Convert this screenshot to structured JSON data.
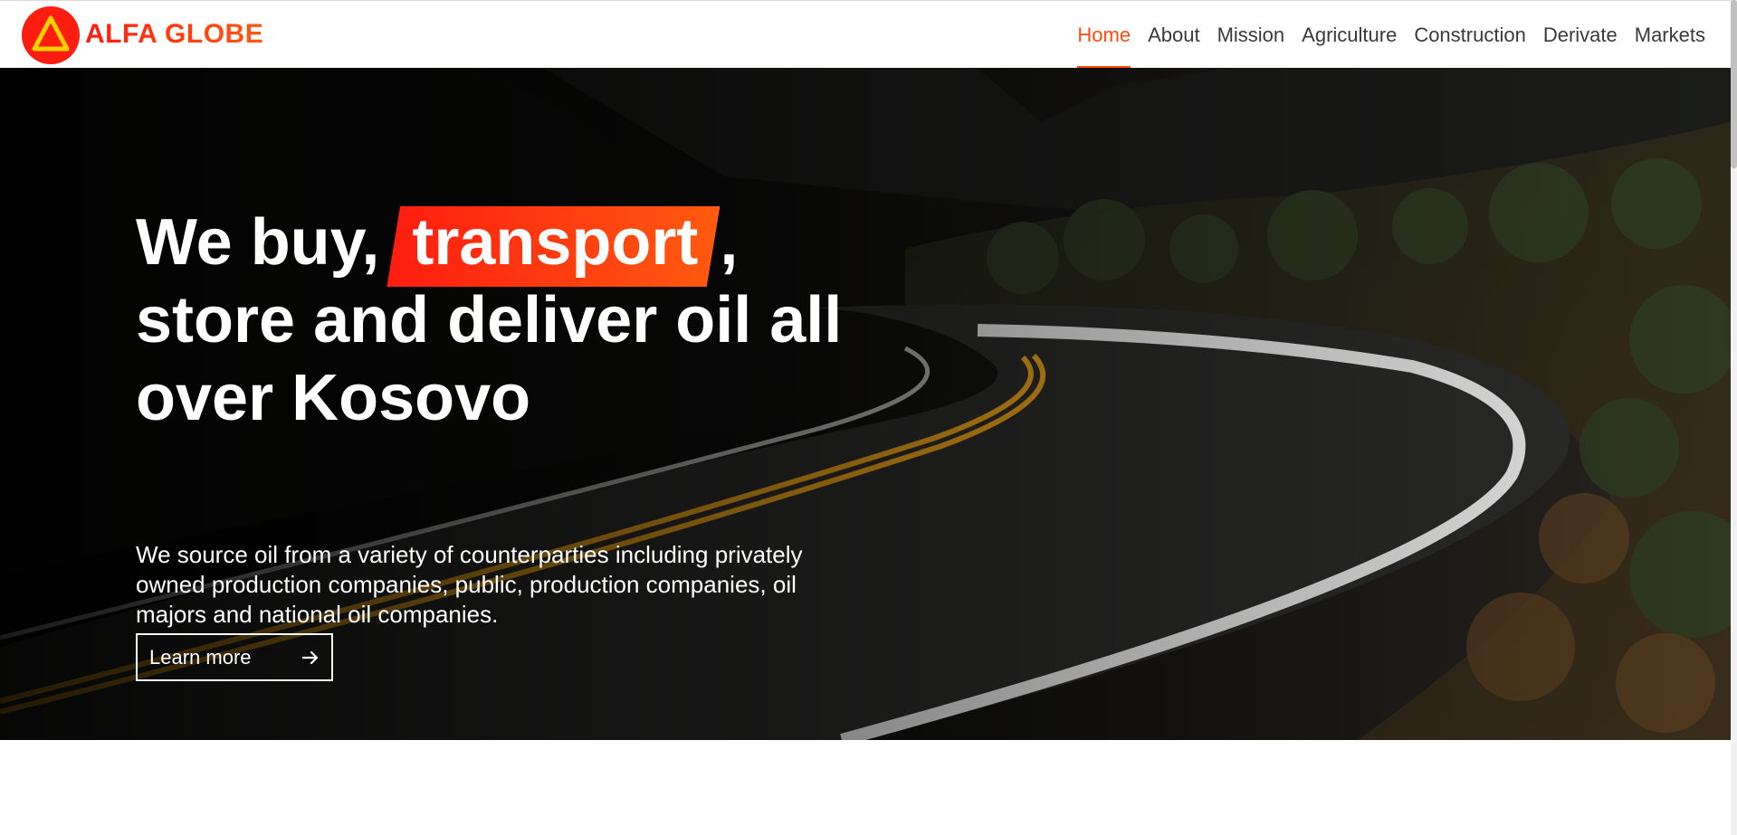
{
  "header": {
    "brand": "ALFA GLOBE",
    "logo_icon": "triangle-logo-icon",
    "nav": [
      {
        "label": "Home",
        "active": true
      },
      {
        "label": "About",
        "active": false
      },
      {
        "label": "Mission",
        "active": false
      },
      {
        "label": "Agriculture",
        "active": false
      },
      {
        "label": "Construction",
        "active": false
      },
      {
        "label": "Derivate",
        "active": false
      },
      {
        "label": "Markets",
        "active": false
      }
    ]
  },
  "hero": {
    "headline_before": "We buy,",
    "headline_highlight": "transport",
    "headline_after_comma": ",",
    "headline_rest": "store and deliver oil all over Kosovo",
    "subtext": "We source oil from a variety of counterparties including privately owned production companies, public, production companies, oil majors and national oil companies.",
    "button_label": "Learn more",
    "button_icon": "arrow-right-icon",
    "background_image": "winding-road-photo"
  },
  "colors": {
    "accent": "#ff4a10",
    "accent_start": "#ff1c10",
    "accent_end": "#ff5a10",
    "hero_bg": "#121211",
    "road_line_yellow": "#e8a21a",
    "road_line_white": "#e9e9e9"
  }
}
